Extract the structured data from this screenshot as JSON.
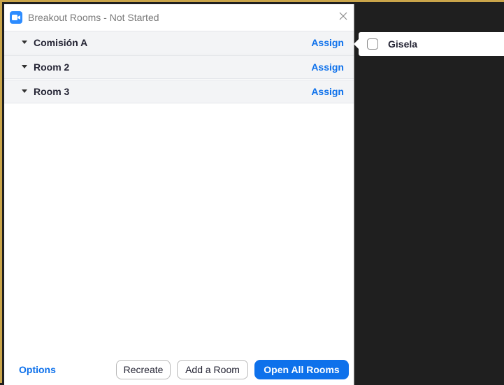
{
  "window": {
    "title": "Breakout Rooms - Not Started"
  },
  "rooms": [
    {
      "name": "Comisión A",
      "action": "Assign"
    },
    {
      "name": "Room 2",
      "action": "Assign"
    },
    {
      "name": "Room 3",
      "action": "Assign"
    }
  ],
  "footer": {
    "options_label": "Options",
    "recreate_label": "Recreate",
    "add_room_label": "Add a Room",
    "open_all_label": "Open All Rooms"
  },
  "assign_popover": {
    "participants": [
      {
        "name": "Gisela",
        "checked": false
      }
    ]
  },
  "icons": {
    "app": "zoom-app-icon",
    "close": "close-icon",
    "expand": "chevron-down-icon"
  },
  "colors": {
    "accent": "#0e71eb",
    "row_bg": "#f3f4f6",
    "background_dark": "#1f1f1f",
    "border_gold": "#caa54a"
  }
}
